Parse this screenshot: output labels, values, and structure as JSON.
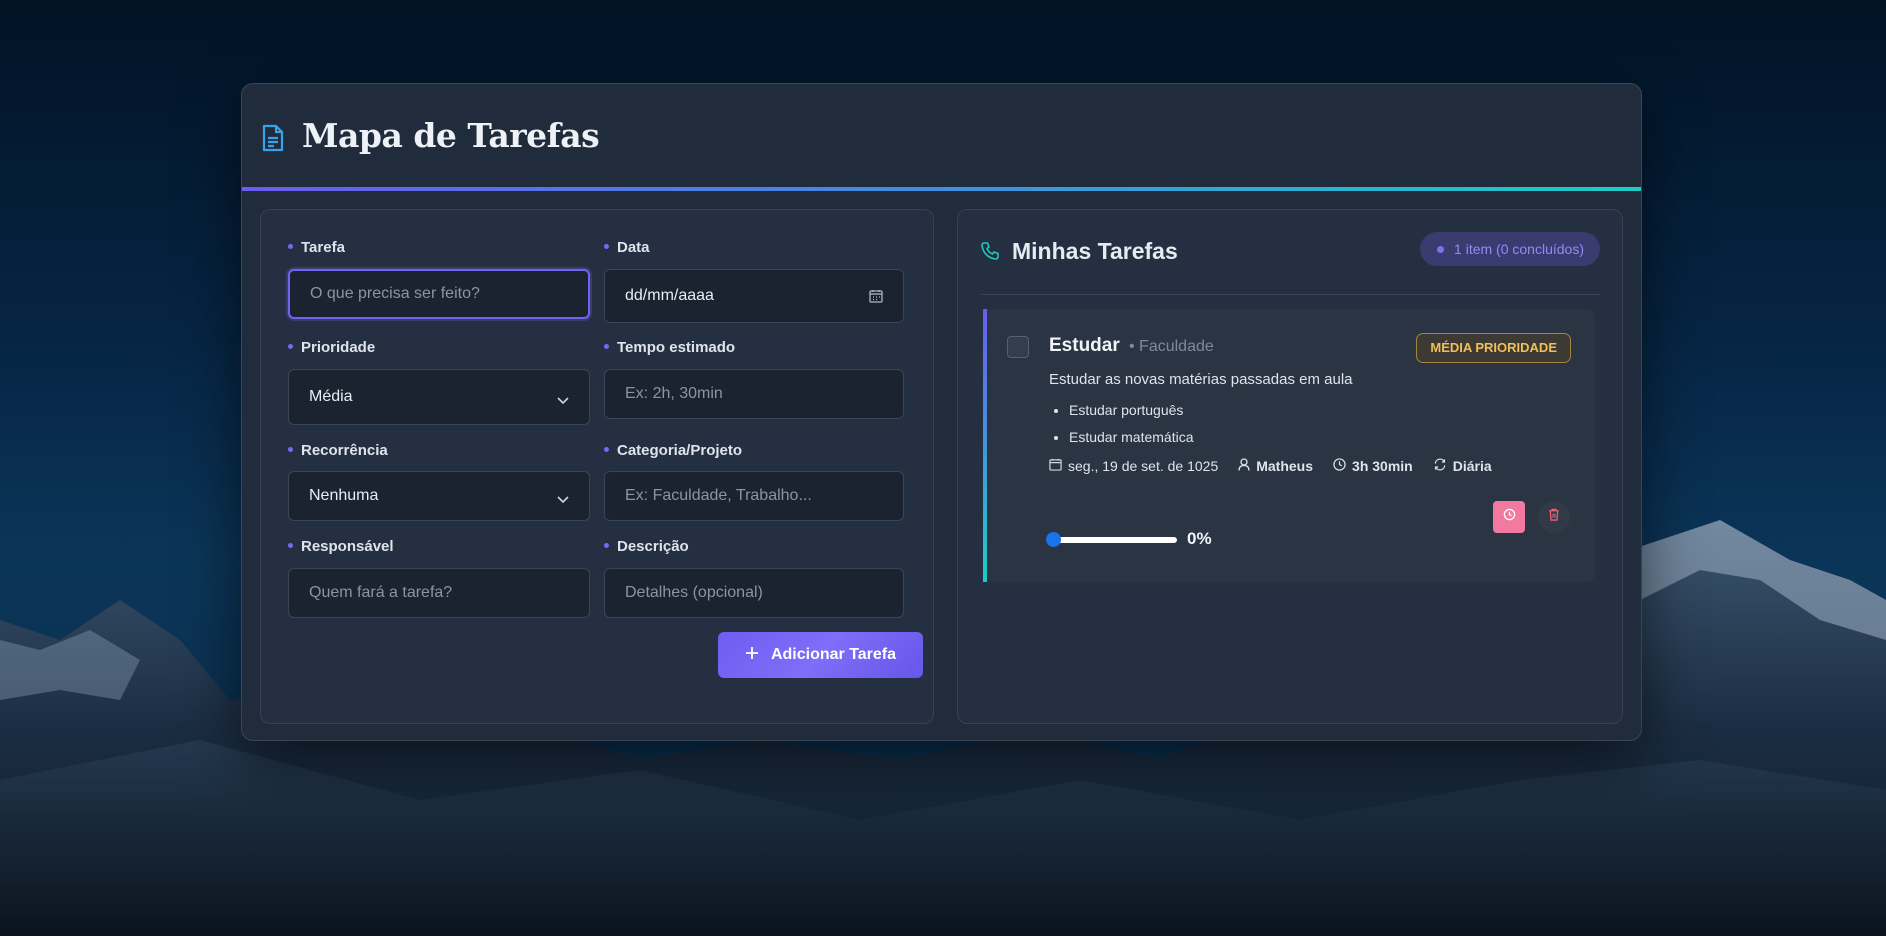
{
  "header": {
    "title": "Mapa de Tarefas",
    "icon": "document-icon"
  },
  "form": {
    "task": {
      "label": "Tarefa",
      "placeholder": "O que precisa ser feito?",
      "value": ""
    },
    "date": {
      "label": "Data",
      "value": "dd/mm/aaaa"
    },
    "priority": {
      "label": "Prioridade",
      "value": "Média"
    },
    "estimated_time": {
      "label": "Tempo estimado",
      "placeholder": "Ex: 2h, 30min"
    },
    "recurrence": {
      "label": "Recorrência",
      "value": "Nenhuma"
    },
    "category": {
      "label": "Categoria/Projeto",
      "placeholder": "Ex: Faculdade, Trabalho..."
    },
    "responsible": {
      "label": "Responsável",
      "placeholder": "Quem fará a tarefa?"
    },
    "description": {
      "label": "Descrição",
      "placeholder": "Detalhes (opcional)"
    },
    "submit_label": "Adicionar Tarefa"
  },
  "list": {
    "title": "Minhas Tarefas",
    "count_label": "1 item (0 concluídos)",
    "tasks": [
      {
        "title": "Estudar",
        "category": "• Faculdade",
        "priority": "MÉDIA PRIORIDADE",
        "description": "Estudar as novas matérias passadas em aula",
        "subtasks": [
          "Estudar português",
          "Estudar matemática"
        ],
        "date": "seg., 19 de set. de 1025",
        "responsible": "Matheus",
        "time": "3h 30min",
        "recurrence": "Diária",
        "progress": 0,
        "progress_label": "0%",
        "done": false
      }
    ]
  },
  "colors": {
    "accent": "#6f63f2",
    "teal": "#1ccdc6",
    "priority_medium": "#f0bf5a",
    "timer": "#f27aa1",
    "delete": "#f0607a"
  }
}
